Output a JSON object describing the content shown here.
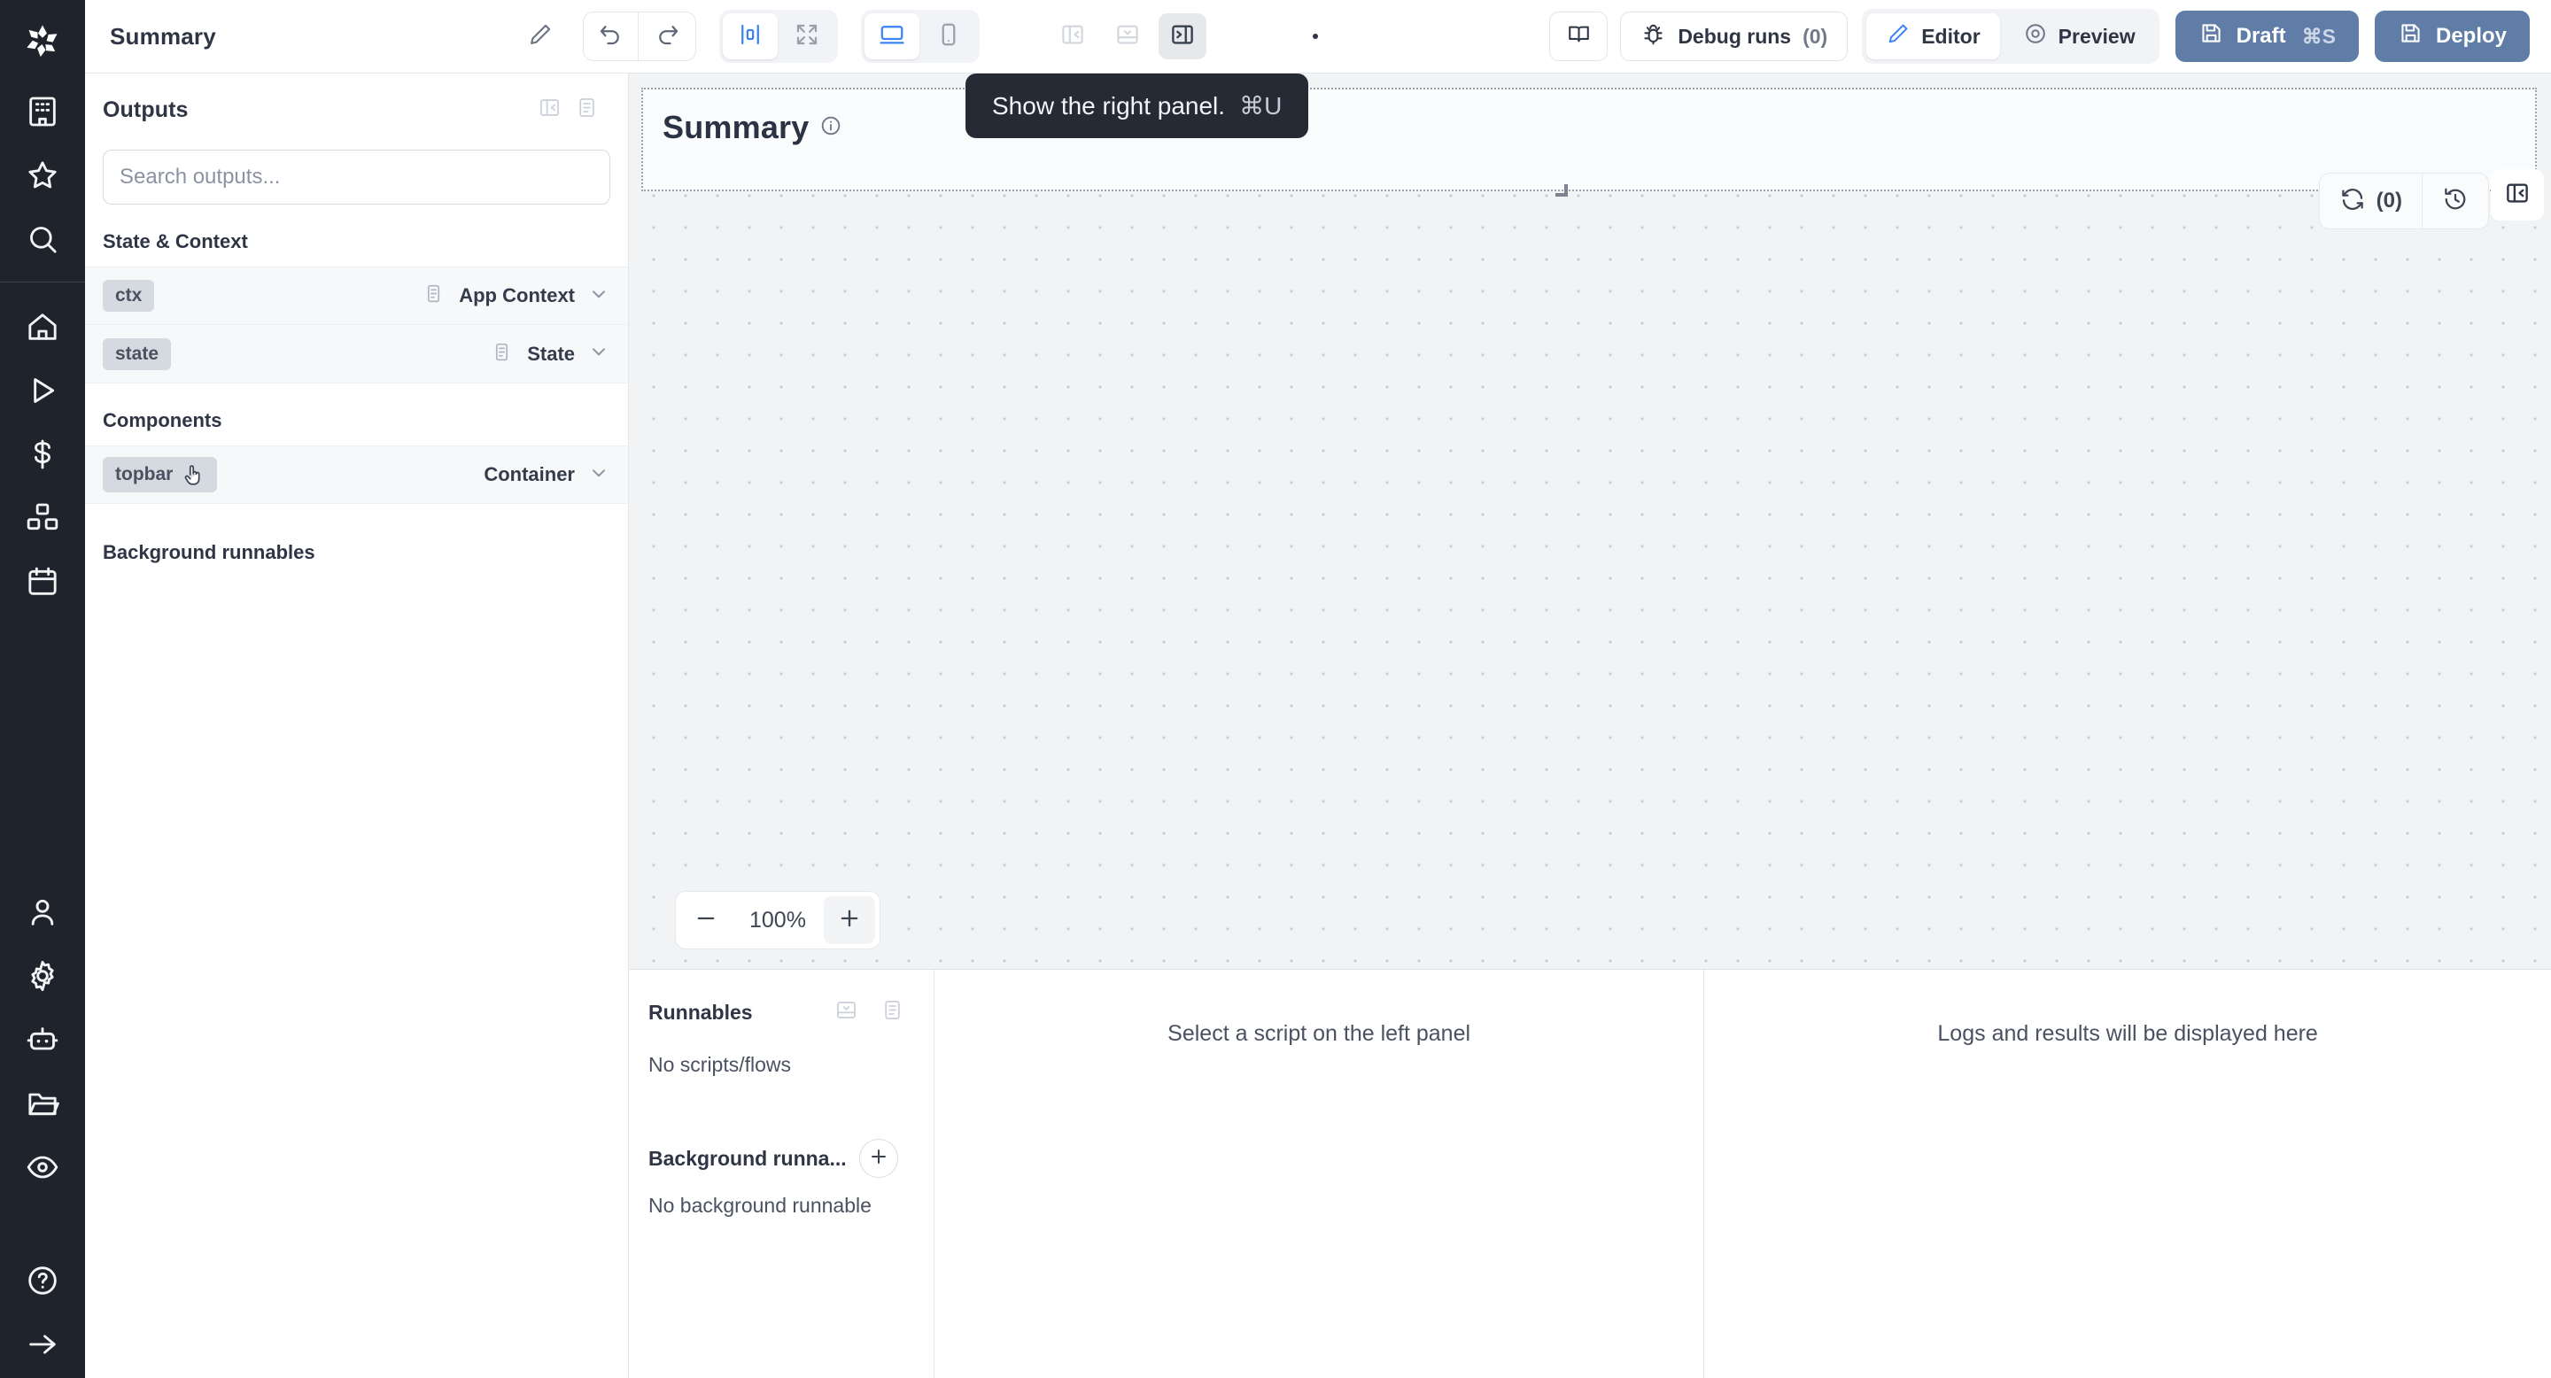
{
  "app": {
    "title": "Summary",
    "brand_dark": "#1f232b",
    "accent_blue": "#3b82f6",
    "primary_button_bg": "#5f7da6"
  },
  "rail": {
    "logo_icon": "windmill-logo-icon",
    "items_top": [
      {
        "icon": "building-icon",
        "name": "workspace"
      },
      {
        "icon": "star-icon",
        "name": "favorites"
      },
      {
        "icon": "search-icon",
        "name": "search"
      }
    ],
    "items_main": [
      {
        "icon": "home-icon",
        "name": "home"
      },
      {
        "icon": "play-icon",
        "name": "runs"
      },
      {
        "icon": "dollar-icon",
        "name": "usage"
      },
      {
        "icon": "boxes-icon",
        "name": "resources"
      },
      {
        "icon": "calendar-icon",
        "name": "schedules"
      }
    ],
    "items_bottom": [
      {
        "icon": "user-icon",
        "name": "account"
      },
      {
        "icon": "gear-icon",
        "name": "settings"
      },
      {
        "icon": "robot-icon",
        "name": "workers"
      },
      {
        "icon": "folder-open-icon",
        "name": "folders"
      },
      {
        "icon": "eye-icon",
        "name": "audit-logs"
      }
    ],
    "items_footer": [
      {
        "icon": "help-circle-icon",
        "name": "help"
      },
      {
        "icon": "arrow-right-icon",
        "name": "expand-rail"
      }
    ]
  },
  "toolbar": {
    "title": "Summary",
    "edit_icon": "pencil-icon",
    "undo_icon": "undo-icon",
    "redo_icon": "redo-icon",
    "align_icon": "align-center-icon",
    "fullscreen_icon": "expand-icon",
    "desktop_icon": "monitor-icon",
    "mobile_icon": "mobile-icon",
    "toggle_left_icon": "panel-left-icon",
    "toggle_bottom_icon": "panel-bottom-icon",
    "toggle_right_icon": "panel-right-icon",
    "kebab_icon": "more-vertical-icon",
    "docs_icon": "book-icon",
    "debug_icon": "bug-icon",
    "debug_label": "Debug runs",
    "debug_count": "(0)",
    "editor_icon": "pencil-icon",
    "editor_label": "Editor",
    "preview_icon": "eye-icon",
    "preview_label": "Preview",
    "draft_icon": "save-icon",
    "draft_label": "Draft",
    "draft_shortcut": "⌘S",
    "deploy_icon": "save-icon",
    "deploy_label": "Deploy"
  },
  "tooltip": {
    "text": "Show the right panel.",
    "shortcut": "⌘U"
  },
  "outputs_panel": {
    "title": "Outputs",
    "collapse_icon": "panel-left-close-icon",
    "list_icon": "list-icon",
    "search": {
      "placeholder": "Search outputs...",
      "value": ""
    },
    "sections": [
      {
        "title": "State & Context",
        "rows": [
          {
            "id": "ctx",
            "type": "App Context",
            "doc_icon": "doc-icon",
            "chevron_icon": "chevron-down-icon"
          },
          {
            "id": "state",
            "type": "State",
            "doc_icon": "doc-icon",
            "chevron_icon": "chevron-down-icon"
          }
        ]
      },
      {
        "title": "Components",
        "rows": [
          {
            "id": "topbar",
            "type": "Container",
            "doc_icon": "",
            "chevron_icon": "chevron-down-icon",
            "cursor": "hand-cursor-icon"
          }
        ]
      }
    ],
    "background_runnables_title": "Background runnables"
  },
  "canvas": {
    "frame_title": "Summary",
    "frame_info_icon": "info-icon",
    "refresh_icon": "refresh-icon",
    "refresh_count": "(0)",
    "history_icon": "history-icon",
    "right_panel_icon": "panel-left-close-icon",
    "zoom": {
      "minus_icon": "minus-icon",
      "value": "100%",
      "plus_icon": "plus-icon"
    }
  },
  "bottom_panel": {
    "runnables": {
      "title": "Runnables",
      "collapse_icon": "panel-bottom-icon",
      "list_icon": "list-icon",
      "empty_text": "No scripts/flows",
      "background_title": "Background runna...",
      "add_icon": "plus-icon",
      "background_empty_text": "No background runnable"
    },
    "center_message": "Select a script on the left panel",
    "right_message": "Logs and results will be displayed here"
  }
}
